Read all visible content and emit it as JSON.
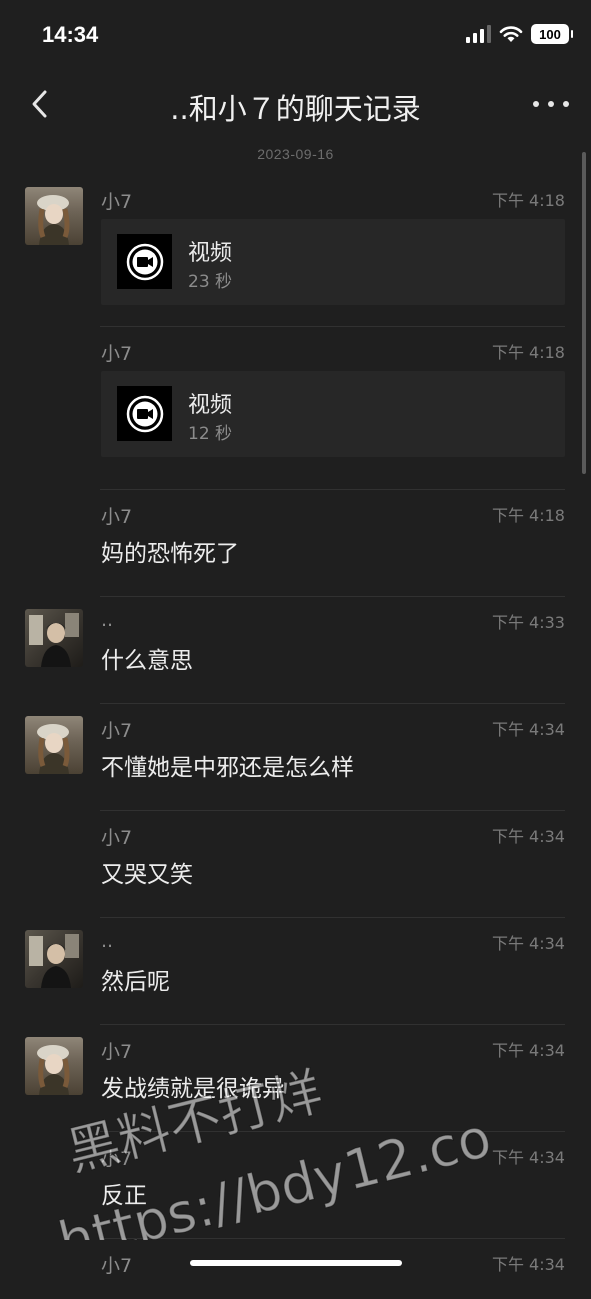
{
  "status_bar": {
    "time": "14:34",
    "battery": "100"
  },
  "header": {
    "title": "..和小７的聊天记录"
  },
  "date_separator": "2023-09-16",
  "messages": [
    {
      "sender": "小7",
      "time": "下午 4:18",
      "avatar": "girl",
      "type": "video",
      "video_label": "视频",
      "duration": "23 秒"
    },
    {
      "sender": "小7",
      "time": "下午 4:18",
      "avatar": "",
      "type": "video",
      "video_label": "视频",
      "duration": "12 秒"
    },
    {
      "sender": "小7",
      "time": "下午 4:18",
      "avatar": "",
      "type": "text",
      "text": "妈的恐怖死了"
    },
    {
      "sender": "..",
      "time": "下午 4:33",
      "avatar": "boy",
      "type": "text",
      "text": "什么意思"
    },
    {
      "sender": "小7",
      "time": "下午 4:34",
      "avatar": "girl",
      "type": "text",
      "text": "不懂她是中邪还是怎么样"
    },
    {
      "sender": "小7",
      "time": "下午 4:34",
      "avatar": "",
      "type": "text",
      "text": "又哭又笑"
    },
    {
      "sender": "..",
      "time": "下午 4:34",
      "avatar": "boy",
      "type": "text",
      "text": "然后呢"
    },
    {
      "sender": "小7",
      "time": "下午 4:34",
      "avatar": "girl",
      "type": "text",
      "text": "发战绩就是很诡异"
    },
    {
      "sender": "小7",
      "time": "下午 4:34",
      "avatar": "",
      "type": "text",
      "text": "反正"
    },
    {
      "sender": "小7",
      "time": "下午 4:34",
      "avatar": "",
      "type": "text",
      "text": ""
    }
  ],
  "watermark": {
    "line1": "黑料不打烊",
    "line2": "https://bdy12.co"
  },
  "icons": {
    "back": "chevron-left-icon",
    "more": "more-dots-icon",
    "video": "video-camera-icon"
  }
}
